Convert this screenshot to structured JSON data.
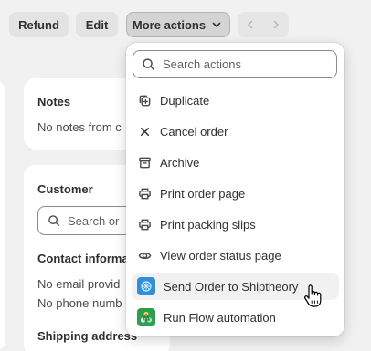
{
  "toolbar": {
    "refund_label": "Refund",
    "edit_label": "Edit",
    "more_actions_label": "More actions"
  },
  "notes": {
    "title": "Notes",
    "text": "No notes from c"
  },
  "customer": {
    "title": "Customer",
    "search_placeholder": "Search or",
    "contact_title": "Contact informa",
    "email_text": "No email provid",
    "phone_text": "No phone numb",
    "shipping_title": "Shipping address"
  },
  "menu": {
    "search_placeholder": "Search actions",
    "items": [
      {
        "label": "Duplicate",
        "icon": "duplicate-icon"
      },
      {
        "label": "Cancel order",
        "icon": "x-icon"
      },
      {
        "label": "Archive",
        "icon": "archive-icon"
      },
      {
        "label": "Print order page",
        "icon": "printer-icon"
      },
      {
        "label": "Print packing slips",
        "icon": "printer-icon"
      },
      {
        "label": "View order status page",
        "icon": "eye-icon"
      },
      {
        "label": "Send Order to Shiptheory",
        "icon": "shiptheory-app-icon"
      },
      {
        "label": "Run Flow automation",
        "icon": "flow-app-icon"
      }
    ]
  },
  "colors": {
    "background": "#f1f1f1",
    "card": "#ffffff",
    "button": "#e3e3e3",
    "hover": "#f1f1f1",
    "shiptheory": "#2f8fd8",
    "flow": "#2f9e4f"
  }
}
